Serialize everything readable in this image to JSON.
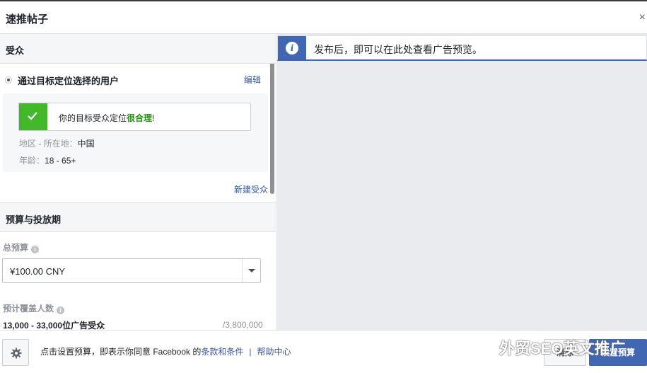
{
  "header": {
    "title": "速推帖子",
    "close": "×"
  },
  "audience": {
    "section_title": "受众",
    "option_label": "通过目标定位选择的用户",
    "edit_label": "编辑",
    "check_text_prefix": "你的目标受众定位",
    "check_text_highlight": "很合理",
    "check_text_suffix": "!",
    "location_label": "地区 - 所在地：",
    "location_value": "中国",
    "age_label": "年龄：",
    "age_value": "18 - 65+",
    "new_audience_label": "新建受众"
  },
  "budget": {
    "section_title": "预算与投放期",
    "total_label": "总预算",
    "total_value": "¥100.00 CNY",
    "reach_label": "预计覆盖人数",
    "reach_value": "13,000 - 33,000位广告受众",
    "reach_total": "/3,800,000"
  },
  "preview": {
    "notice_icon": "info-icon",
    "notice_text": "发布后，即可以在此处查看广告预览。"
  },
  "footer": {
    "terms_prefix": "点击设置预算，即表示你同意 Facebook 的",
    "terms_link": "条款和条件",
    "separator": "|",
    "help_link": "帮助中心",
    "clear_button": "清除",
    "set_budget_button": "设置预算",
    "watermark": "外贸SEO英文推广"
  },
  "colors": {
    "brand_blue": "#4267b2",
    "link_blue": "#365899",
    "success_green": "#42b72a",
    "highlight_green": "#238f14"
  }
}
